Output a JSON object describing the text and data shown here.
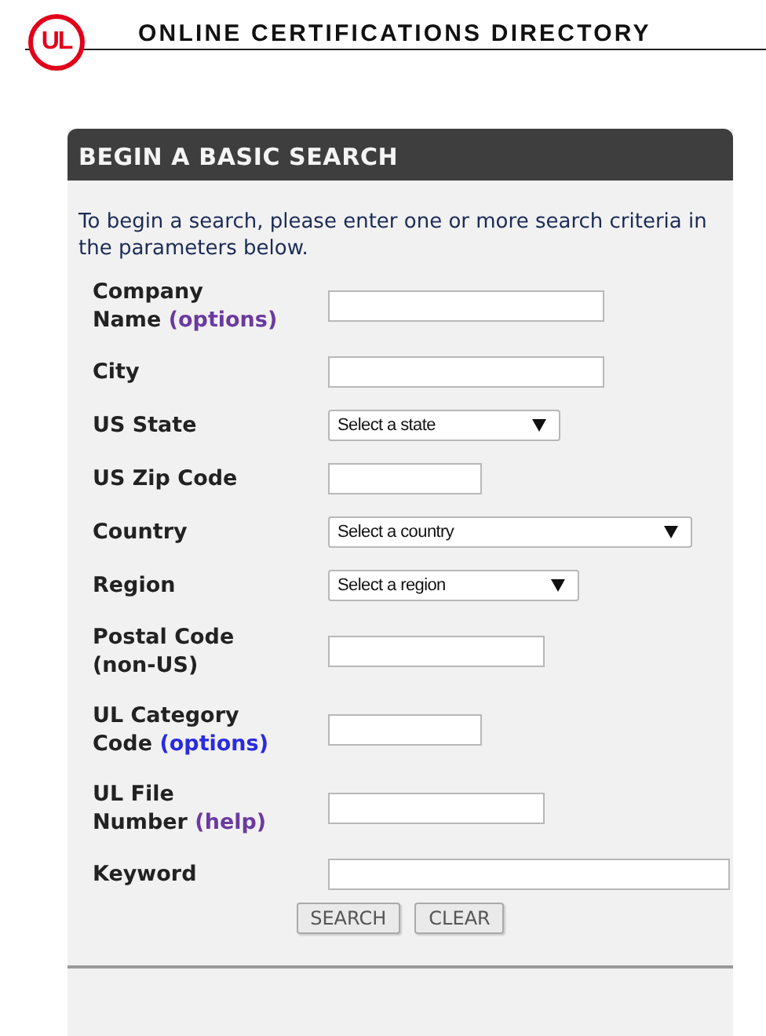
{
  "header": {
    "logo": "UL",
    "title": "ONLINE CERTIFICATIONS DIRECTORY"
  },
  "panel": {
    "title": "BEGIN A BASIC SEARCH",
    "intro": "To begin a search, please enter one or more search criteria in the parameters below."
  },
  "fields": [
    {
      "label": [
        "Company",
        "Name"
      ],
      "link": "(options)",
      "kind": "text"
    },
    {
      "label": [
        "City"
      ],
      "kind": "text"
    },
    {
      "label": [
        "US State"
      ],
      "kind": "select",
      "value": "Select a state"
    },
    {
      "label": [
        "US Zip Code"
      ],
      "kind": "text"
    },
    {
      "label": [
        "Country"
      ],
      "kind": "select",
      "value": "Select a country"
    },
    {
      "label": [
        "Region"
      ],
      "kind": "select",
      "value": "Select a region"
    },
    {
      "label": [
        "Postal Code",
        "(non-US)"
      ],
      "kind": "text"
    },
    {
      "label": [
        "UL Category",
        "Code"
      ],
      "link": "(options)",
      "kind": "text"
    },
    {
      "label": [
        "UL File",
        "Number"
      ],
      "link": "(help)",
      "kind": "text"
    },
    {
      "label": [
        "Keyword"
      ],
      "kind": "text"
    }
  ],
  "buttons": [
    "SEARCH",
    "CLEAR"
  ]
}
